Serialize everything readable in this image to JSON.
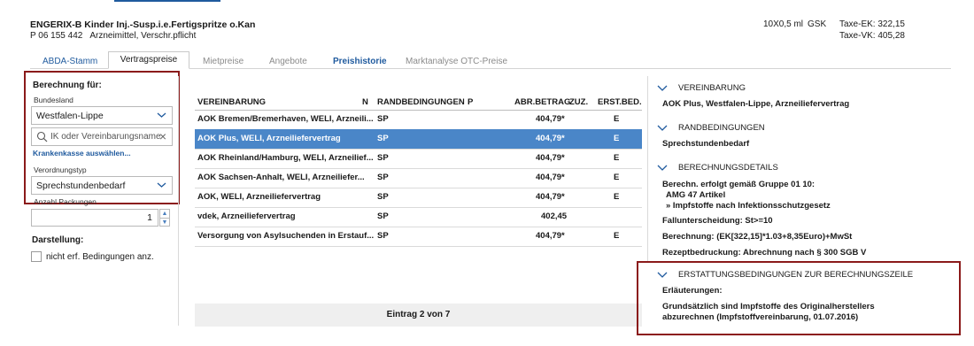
{
  "header": {
    "product_title": "ENGERIX-B Kinder Inj.-Susp.i.e.Fertigspritze o.Kan",
    "pzn": "P 06 155 442",
    "category": "Arzneimittel, Verschr.pflicht",
    "package": "10X0,5 ml",
    "manufacturer": "GSK",
    "taxe_ek": "Taxe-EK:  322,15",
    "taxe_vk": "Taxe-VK:  405,28"
  },
  "tabs": [
    {
      "label": "ABDA-Stamm"
    },
    {
      "label": "Vertragspreise"
    },
    {
      "label": "Mietpreise"
    },
    {
      "label": "Angebote"
    },
    {
      "label": "Preishistorie"
    },
    {
      "label": "Marktanalyse OTC-Preise"
    }
  ],
  "left_panel": {
    "title": "Berechnung für:",
    "bundesland_label": "Bundesland",
    "bundesland_value": "Westfalen-Lippe",
    "search_placeholder": "IK oder Vereinbarungsname",
    "krankenkasse_link": "Krankenkasse auswählen...",
    "verordnungstyp_label": "Verordnungstyp",
    "verordnungstyp_value": "Sprechstundenbedarf",
    "anzahl_label": "Anzahl Packungen",
    "anzahl_value": "1",
    "darstellung_label": "Darstellung:",
    "checkbox_label": "nicht erf. Bedingungen anz."
  },
  "table": {
    "headers": {
      "vereinbarung": "VEREINBARUNG",
      "n": "N",
      "randbedingungen": "RANDBEDINGUNGEN",
      "p": "P",
      "abr_betrag": "ABR.BETRAG",
      "zuz": "ZUZ.",
      "erst_bed": "ERST.BED."
    },
    "rows": [
      {
        "vereinbarung": "AOK Bremen/Bremerhaven, WELI, Arzneili...",
        "randbedingungen": "SP",
        "betrag": "404,79*",
        "erst": "E"
      },
      {
        "vereinbarung": "AOK Plus, WELI, Arzneiliefervertrag",
        "randbedingungen": "SP",
        "betrag": "404,79*",
        "erst": "E"
      },
      {
        "vereinbarung": "AOK Rheinland/Hamburg, WELI, Arzneilief...",
        "randbedingungen": "SP",
        "betrag": "404,79*",
        "erst": "E"
      },
      {
        "vereinbarung": "AOK Sachsen-Anhalt, WELI, Arzneiliefer...",
        "randbedingungen": "SP",
        "betrag": "404,79*",
        "erst": "E"
      },
      {
        "vereinbarung": "AOK, WELI, Arzneiliefervertrag",
        "randbedingungen": "SP",
        "betrag": "404,79*",
        "erst": "E"
      },
      {
        "vereinbarung": "vdek, Arzneiliefervertrag",
        "randbedingungen": "SP",
        "betrag": "402,45",
        "erst": ""
      },
      {
        "vereinbarung": "Versorgung von Asylsuchenden in Erstauf...",
        "randbedingungen": "SP",
        "betrag": "404,79*",
        "erst": "E"
      }
    ],
    "footer": "Eintrag 2 von 7"
  },
  "right_panel": {
    "vereinbarung_title": "VEREINBARUNG",
    "vereinbarung_value": "AOK Plus, Westfalen-Lippe, Arzneiliefervertrag",
    "randbedingungen_title": "RANDBEDINGUNGEN",
    "randbedingungen_value": "Sprechstundenbedarf",
    "berechnungsdetails_title": "BERECHNUNGSDETAILS",
    "details_line1": "Berechn. erfolgt gemäß Gruppe 01 10:",
    "details_line2": "AMG 47 Artikel",
    "details_line3": "» Impfstoffe nach Infektionsschutzgesetz",
    "details_line4": "Fallunterscheidung: St>=10",
    "details_line5": "Berechnung: (EK[322,15]*1.03+8,35Euro)+MwSt",
    "details_line6": "Rezeptbedruckung: Abrechnung nach § 300 SGB V",
    "erstattung_title": "ERSTATTUNGSBEDINGUNGEN ZUR BERECHNUNGSZEILE",
    "erlaeuterungen": "Erläuterungen:",
    "erstattung_line1": "Grundsätzlich sind Impfstoffe des Originalherstellers",
    "erstattung_line2": "abzurechnen (Impfstoffvereinbarung, 01.07.2016)"
  },
  "colors": {
    "accent_blue": "#1f5a9e",
    "selected_row": "#4a86c8",
    "highlight_border": "#8b1a1a"
  }
}
